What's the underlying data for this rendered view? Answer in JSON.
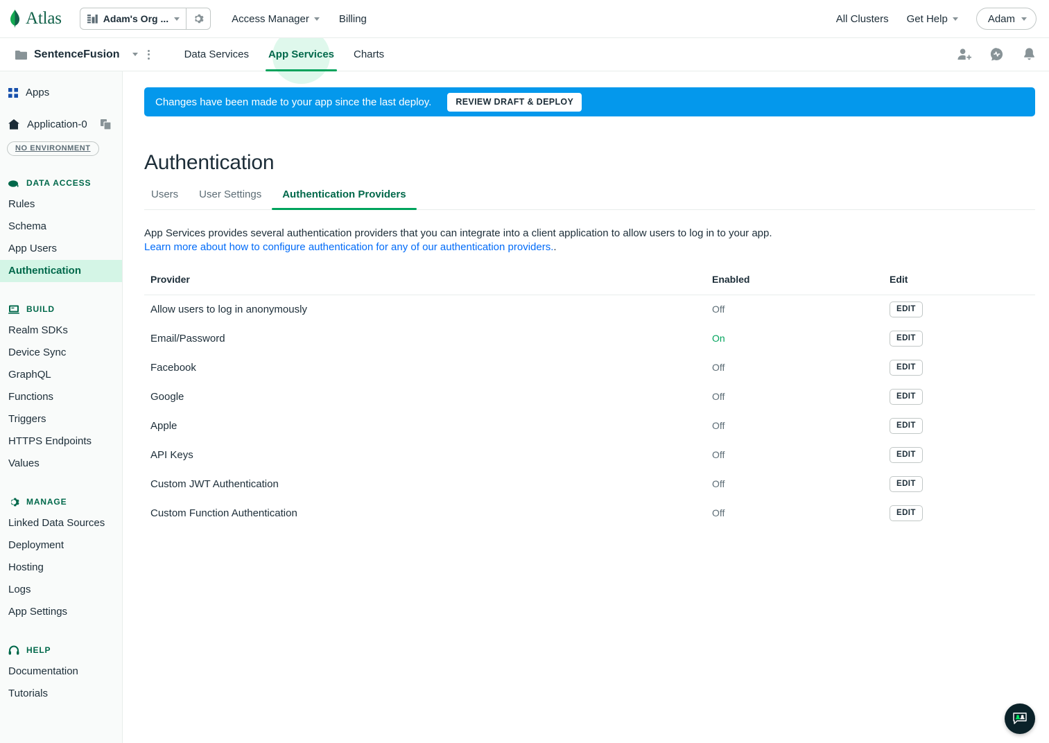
{
  "header": {
    "brand": "Atlas",
    "brand_icon": "mongodb-leaf-icon",
    "org_selector": {
      "label": "Adam's Org ...",
      "icon": "org-grid-icon",
      "caret_icon": "chevron-down-icon",
      "gear_icon": "gear-icon"
    },
    "nav": [
      {
        "label": "Access Manager",
        "has_caret": true
      },
      {
        "label": "Billing",
        "has_caret": false
      }
    ],
    "right": [
      {
        "label": "All Clusters",
        "has_caret": false
      },
      {
        "label": "Get Help",
        "has_caret": true
      }
    ],
    "user": {
      "label": "Adam",
      "caret_icon": "chevron-down-icon"
    }
  },
  "subnav": {
    "project": {
      "name": "SentenceFusion",
      "folder_icon": "folder-icon",
      "caret_icon": "chevron-down-icon",
      "kebab_icon": "kebab-menu-icon"
    },
    "tabs": [
      {
        "label": "Data Services",
        "active": false
      },
      {
        "label": "App Services",
        "active": true
      },
      {
        "label": "Charts",
        "active": false
      }
    ],
    "icons": [
      {
        "name": "invite-user-icon"
      },
      {
        "name": "activity-feed-icon"
      },
      {
        "name": "bell-icon"
      }
    ]
  },
  "sidebar": {
    "apps": {
      "label": "Apps",
      "icon": "apps-grid-icon"
    },
    "application": {
      "label": "Application-0",
      "home_icon": "home-icon",
      "copy_icon": "copy-icon"
    },
    "environment_badge": "NO ENVIRONMENT",
    "sections": [
      {
        "title": "DATA ACCESS",
        "icon": "cloud-icon",
        "items": [
          {
            "label": "Rules",
            "active": false
          },
          {
            "label": "Schema",
            "active": false
          },
          {
            "label": "App Users",
            "active": false
          },
          {
            "label": "Authentication",
            "active": true
          }
        ]
      },
      {
        "title": "BUILD",
        "icon": "laptop-icon",
        "items": [
          {
            "label": "Realm SDKs",
            "active": false
          },
          {
            "label": "Device Sync",
            "active": false
          },
          {
            "label": "GraphQL",
            "active": false
          },
          {
            "label": "Functions",
            "active": false
          },
          {
            "label": "Triggers",
            "active": false
          },
          {
            "label": "HTTPS Endpoints",
            "active": false
          },
          {
            "label": "Values",
            "active": false
          }
        ]
      },
      {
        "title": "MANAGE",
        "icon": "gear-icon",
        "items": [
          {
            "label": "Linked Data Sources",
            "active": false
          },
          {
            "label": "Deployment",
            "active": false
          },
          {
            "label": "Hosting",
            "active": false
          },
          {
            "label": "Logs",
            "active": false
          },
          {
            "label": "App Settings",
            "active": false
          }
        ]
      },
      {
        "title": "HELP",
        "icon": "lifesaver-icon",
        "items": [
          {
            "label": "Documentation",
            "active": false
          },
          {
            "label": "Tutorials",
            "active": false
          }
        ]
      }
    ]
  },
  "main": {
    "banner": {
      "message": "Changes have been made to your app since the last deploy.",
      "button": "REVIEW DRAFT & DEPLOY",
      "color": "#0498ec"
    },
    "page_title": "Authentication",
    "tabs": [
      {
        "label": "Users",
        "active": false
      },
      {
        "label": "User Settings",
        "active": false
      },
      {
        "label": "Authentication Providers",
        "active": true
      }
    ],
    "description": "App Services provides several authentication providers that you can integrate into a client application to allow users to log in to your app.",
    "link_text": "Learn more about how to configure authentication for any of our authentication providers.",
    "table": {
      "columns": [
        "Provider",
        "Enabled",
        "Edit"
      ],
      "edit_label": "EDIT",
      "rows": [
        {
          "provider": "Allow users to log in anonymously",
          "enabled": "Off",
          "on": false
        },
        {
          "provider": "Email/Password",
          "enabled": "On",
          "on": true
        },
        {
          "provider": "Facebook",
          "enabled": "Off",
          "on": false
        },
        {
          "provider": "Google",
          "enabled": "Off",
          "on": false
        },
        {
          "provider": "Apple",
          "enabled": "Off",
          "on": false
        },
        {
          "provider": "API Keys",
          "enabled": "Off",
          "on": false
        },
        {
          "provider": "Custom JWT Authentication",
          "enabled": "Off",
          "on": false
        },
        {
          "provider": "Custom Function Authentication",
          "enabled": "Off",
          "on": false
        }
      ]
    },
    "fab": {
      "icon": "feedback-chat-icon"
    }
  },
  "colors": {
    "accent_green": "#00684a",
    "active_green": "#00a35c",
    "highlight_mint": "#d4f5e6",
    "banner_blue": "#0498ec",
    "link_blue": "#016bf8"
  }
}
